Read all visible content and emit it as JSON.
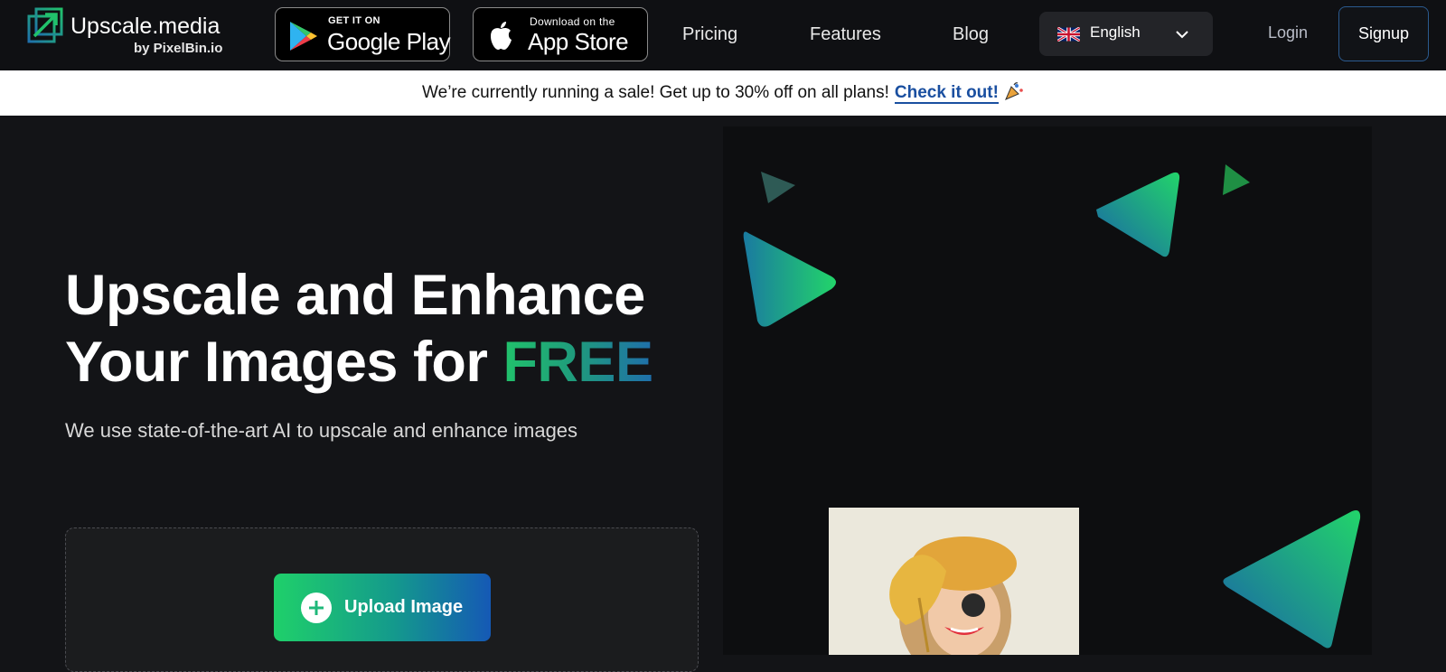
{
  "brand": {
    "name": "Upscale.media",
    "byline": "by PixelBin.io"
  },
  "header": {
    "google_play": {
      "small": "GET IT ON",
      "big": "Google Play"
    },
    "app_store": {
      "small": "Download on the",
      "big": "App Store"
    },
    "nav": [
      "Pricing",
      "Features",
      "Blog"
    ],
    "language": "English",
    "login": "Login",
    "signup": "Signup"
  },
  "sale_banner": {
    "text": "We’re currently running a sale! Get up to 30% off on all plans!",
    "link": "Check it out!"
  },
  "hero": {
    "title_line1": "Upscale and Enhance",
    "title_line2_prefix": "Your Images for ",
    "title_highlight": "FREE",
    "subtitle": "We use state-of-the-art AI to upscale and enhance images",
    "upload_button": "Upload Image"
  },
  "colors": {
    "background": "#131417",
    "accent_green": "#21c26b",
    "accent_blue": "#1559b5",
    "link_blue": "#1a4fa0"
  }
}
